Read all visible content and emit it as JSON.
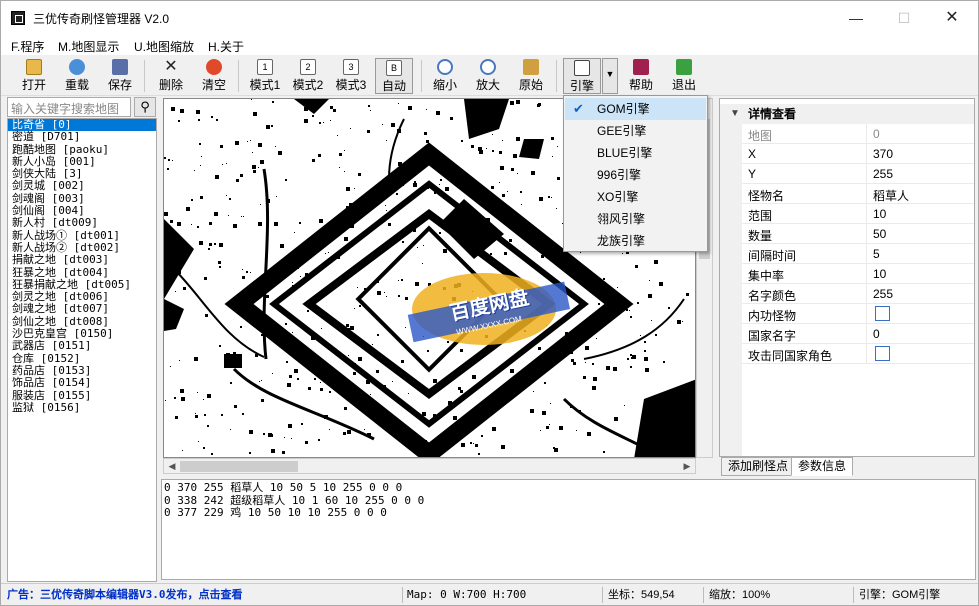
{
  "window": {
    "title": "三优传奇刷怪管理器 V2.0"
  },
  "menu": [
    "F.程序",
    "M.地图显示",
    "U.地图缩放",
    "H.关于"
  ],
  "toolbar": {
    "open": "打开",
    "reload": "重载",
    "save": "保存",
    "delete": "删除",
    "clear": "清空",
    "mode1": "模式1",
    "mode2": "模式2",
    "mode3": "模式3",
    "auto": "自动",
    "zoom_out": "缩小",
    "zoom_in": "放大",
    "original": "原始",
    "engine": "引擎",
    "help": "帮助",
    "exit": "退出"
  },
  "search": {
    "placeholder": "输入关键字搜索地图"
  },
  "maps": [
    "比奇省 [0]",
    "密道 [D701]",
    "跑酷地图 [paoku]",
    "新人小岛 [001]",
    "剑侠大陆 [3]",
    "剑灵城 [002]",
    "剑魂阁 [003]",
    "剑仙阁 [004]",
    "新人村 [dt009]",
    "新人战场① [dt001]",
    "新人战场② [dt002]",
    "捐献之地 [dt003]",
    "狂暴之地 [dt004]",
    "狂暴捐献之地 [dt005]",
    "剑灵之地 [dt006]",
    "剑魂之地 [dt007]",
    "剑仙之地 [dt008]",
    "沙巴克皇宫 [0150]",
    "武器店 [0151]",
    "仓库 [0152]",
    "药品店 [0153]",
    "饰品店 [0154]",
    "服装店 [0155]",
    "监狱 [0156]"
  ],
  "engine_menu": {
    "items": [
      "GOM引擎",
      "GEE引擎",
      "BLUE引擎",
      "996引擎",
      "XO引擎",
      "翎风引擎",
      "龙族引擎"
    ],
    "checked": "GOM引擎"
  },
  "props": {
    "header": "详情查看",
    "rows": [
      {
        "key": "地图",
        "value": "0",
        "dim": true
      },
      {
        "key": "X",
        "value": "370"
      },
      {
        "key": "Y",
        "value": "255"
      },
      {
        "key": "怪物名",
        "value": "稻草人"
      },
      {
        "key": "范围",
        "value": "10"
      },
      {
        "key": "数量",
        "value": "50"
      },
      {
        "key": "间隔时间",
        "value": "5"
      },
      {
        "key": "集中率",
        "value": "10"
      },
      {
        "key": "名字颜色",
        "value": "255"
      },
      {
        "key": "内功怪物",
        "value": "",
        "checkbox": true
      },
      {
        "key": "国家名字",
        "value": "0"
      },
      {
        "key": "攻击同国家角色",
        "value": "",
        "checkbox": true
      }
    ]
  },
  "tabs": [
    "添加刷怪点",
    "参数信息"
  ],
  "output_lines": [
    "0 370 255 稻草人 10 50 5 10 255 0 0 0",
    "0 338 242 超级稻草人 10 1 60 10 255 0 0 0",
    "0 377 229 鸡 10 50 10 10 255 0 0 0"
  ],
  "status": {
    "ad": "广告：三优传奇脚本编辑器V3.0发布，点击查看",
    "mapinfo": "Map: 0  W:700 H:700",
    "coords": "坐标：549,54",
    "zoom": "缩放：100%",
    "engine": "引擎：GOM引擎"
  },
  "watermark": {
    "text": "百度网盘",
    "sub": "WWW.XXXX.COM"
  }
}
